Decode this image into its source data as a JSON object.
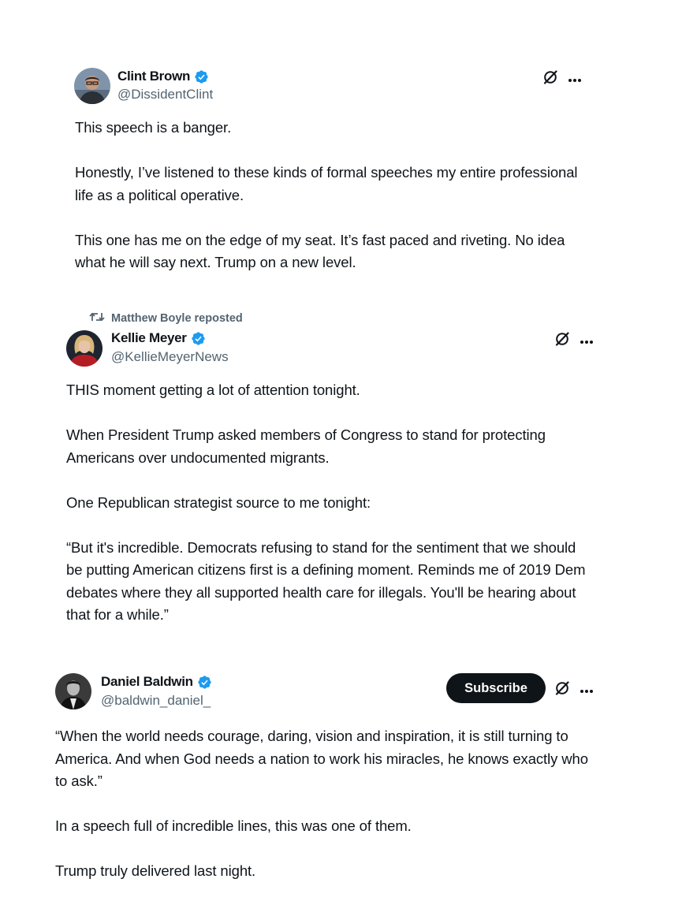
{
  "posts": [
    {
      "display_name": "Clint Brown",
      "handle": "@DissidentClint",
      "verified": true,
      "avatar_icon": "avatar-man-glasses",
      "paragraphs": [
        "This speech is a banger.",
        "Honestly, I’ve listened to these kinds of formal speeches my entire professional life as a political operative.",
        "This one has me on the edge of my seat. It’s fast paced and riveting. No idea what he will say next. Trump on a new level."
      ]
    },
    {
      "repost_label": "Matthew Boyle reposted",
      "display_name": "Kellie Meyer",
      "handle": "@KellieMeyerNews",
      "verified": true,
      "avatar_icon": "avatar-woman-blonde",
      "paragraphs": [
        "THIS moment getting a lot of attention tonight.",
        "When President Trump asked members of Congress to stand for protecting Americans over undocumented migrants.",
        "One Republican strategist source to me tonight:",
        "“But it's incredible. Democrats refusing to stand for the sentiment that we should be putting American citizens first is a defining moment. Reminds me of 2019 Dem debates where they all supported health care for illegals. You'll be hearing about that for a while.”"
      ]
    },
    {
      "display_name": "Daniel Baldwin",
      "handle": "@baldwin_daniel_",
      "verified": true,
      "avatar_icon": "avatar-man-bw",
      "subscribe_label": "Subscribe",
      "paragraphs": [
        "“When the world needs courage, daring, vision and inspiration, it is still turning to America. And when God needs a nation to work his miracles, he knows exactly who to ask.”",
        "In a speech full of incredible lines, this was one of them.",
        "Trump truly delivered last night."
      ]
    }
  ],
  "icons": {
    "verified": "verified-badge-icon",
    "grok": "grok-icon",
    "more": "more-options-icon",
    "repost": "repost-icon"
  },
  "colors": {
    "verified_blue": "#1d9bf0",
    "text_primary": "#0f1419",
    "text_secondary": "#536471",
    "subscribe_bg": "#0f1419"
  }
}
